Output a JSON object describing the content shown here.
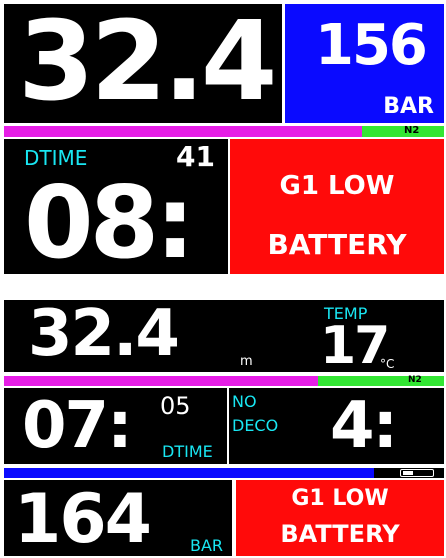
{
  "screen1": {
    "depth": "32.4",
    "pressure": "156",
    "pressure_unit": "BAR",
    "gas": "N2",
    "dtime_label": "DTIME",
    "dtime_value": "41",
    "time": "08:",
    "alert_line1": "G1 LOW",
    "alert_line2": "BATTERY"
  },
  "screen2": {
    "depth": "32.4",
    "depth_unit": "m",
    "temp_label": "TEMP",
    "temp_value": "17",
    "temp_unit": "°C",
    "gas": "N2",
    "time": "07:",
    "time_seconds": "05",
    "dtime_label": "DTIME",
    "nodeco_line1": "NO",
    "nodeco_line2": "DECO",
    "nodeco_value": "4:",
    "pressure": "164",
    "pressure_unit": "BAR",
    "alert_line1": "G1 LOW",
    "alert_line2": "BATTERY"
  },
  "colors": {
    "magenta": "#e61ee6",
    "green": "#33e633",
    "blue": "#0a0aff",
    "red": "#ff0a0a",
    "cyan": "#19e6f2",
    "black": "#000000"
  }
}
